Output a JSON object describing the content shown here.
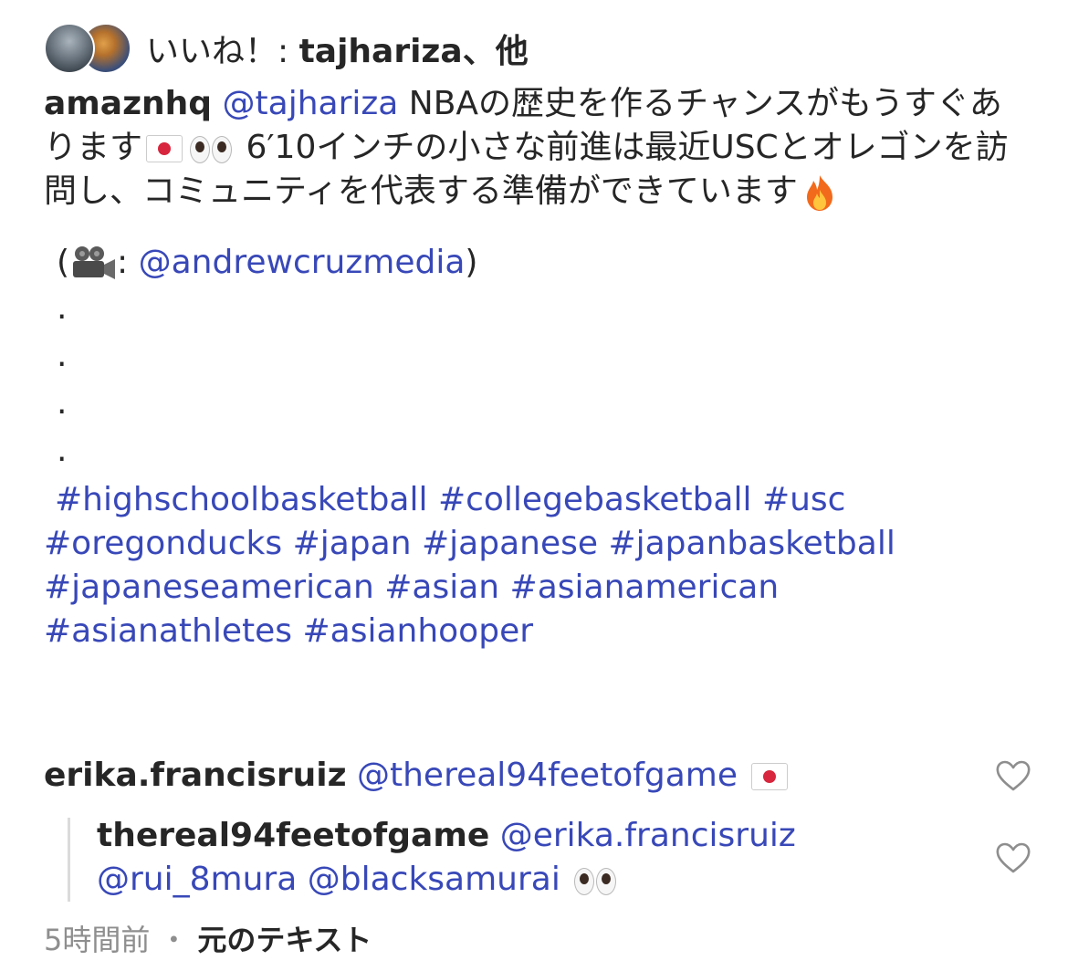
{
  "likes": {
    "label": "いいね！: ",
    "user": "tajhariza",
    "suffix": "、他"
  },
  "caption": {
    "author": "amaznhq",
    "mention": "@tajhariza",
    "text_1": " NBAの歴史を作るチャンスがもうすぐあります",
    "text_2": " 6′10インチの小さな前進は最近USCとオレゴンを訪問し、コミュニティを代表する準備ができています",
    "credit_open": "(",
    "credit_colon": ": ",
    "credit_mention": "@andrewcruzmedia",
    "credit_close": ")",
    "dots": [
      ".",
      ".",
      ".",
      "."
    ],
    "hashtags": [
      "#highschoolbasketball",
      "#collegebasketball",
      "#usc",
      "#oregonducks",
      "#japan",
      "#japanese",
      "#japanbasketball",
      "#japaneseamerican",
      "#asian",
      "#asianamerican",
      "#asianathletes",
      "#asianhooper"
    ]
  },
  "comment": {
    "author": "erika.francisruiz",
    "mention": "@thereal94feetofgame"
  },
  "reply": {
    "author": "thereal94feetofgame",
    "mention_1": "@erika.francisruiz",
    "mention_2": "@rui_8mura",
    "mention_3": "@blacksamurai"
  },
  "meta": {
    "time": "5時間前",
    "separator": "・",
    "original_text": "元のテキスト"
  },
  "icons": {
    "heart": "heart-outline-icon",
    "flag": "japan-flag-emoji",
    "eyes": "eyes-emoji",
    "fire": "fire-emoji",
    "camera": "movie-camera-emoji"
  },
  "colors": {
    "link": "#3848b8",
    "text": "#262626",
    "muted": "#8e8e8e"
  }
}
